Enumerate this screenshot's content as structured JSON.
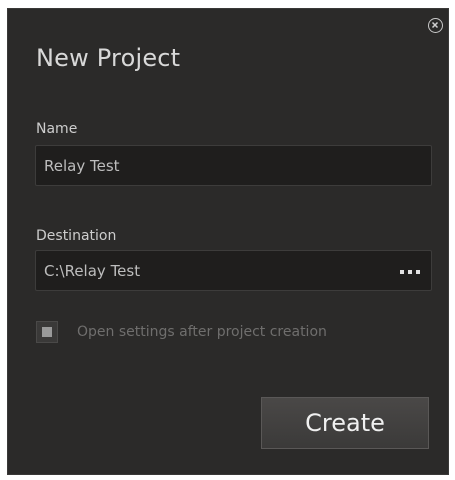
{
  "dialog": {
    "title": "New Project",
    "close_icon": "close-circle-icon"
  },
  "name_field": {
    "label": "Name",
    "value": "Relay Test"
  },
  "destination_field": {
    "label": "Destination",
    "value": "C:\\Relay Test",
    "browse_icon": "ellipsis-icon"
  },
  "open_settings": {
    "label": "Open settings after project creation"
  },
  "create_button": {
    "label": "Create"
  }
}
